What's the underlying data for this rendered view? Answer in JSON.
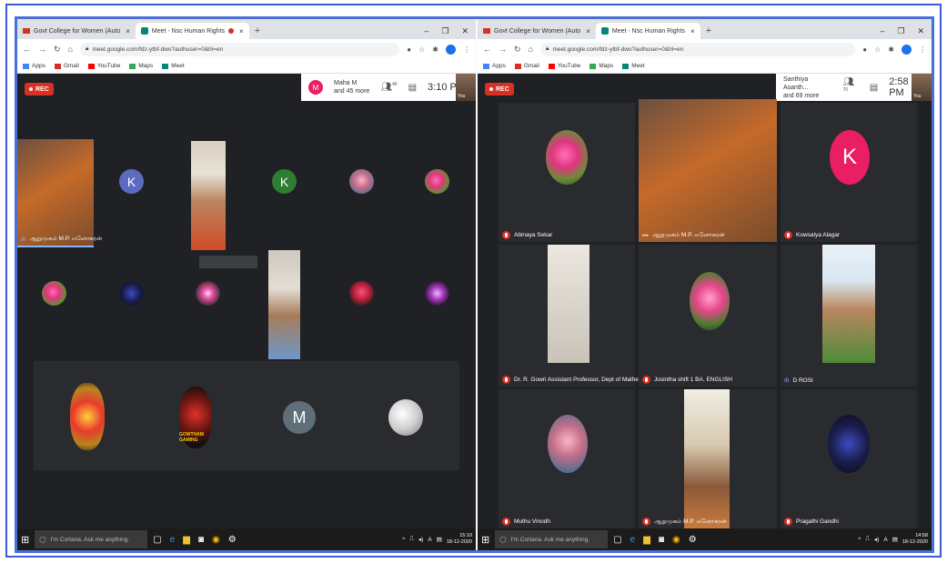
{
  "left": {
    "tabs": [
      {
        "label": "Govt College for Women (Auto"
      },
      {
        "label": "Meet - Nsc Human Rights"
      }
    ],
    "url": "meet.google.com/fdz-ytbf-dwo?authuser=0&hl=en",
    "bookmarks": [
      "Apps",
      "Gmail",
      "YouTube",
      "Maps",
      "Meet"
    ],
    "rec_label": "REC",
    "presenter_initial": "M",
    "presenter_line1": "Maha M",
    "presenter_line2": "and 45 more",
    "participant_count": "46",
    "time": "3:10 PM",
    "self_label": "You",
    "grid": {
      "speaker_name": "ஆறுமுகம் M.P. மனோகரன்",
      "banner_text": "",
      "avatar_k1": "K",
      "avatar_k2": "K",
      "avatar_m": "M",
      "gaming_text": "GOWTHAM GAMING"
    },
    "taskbar": {
      "search_placeholder": "I'm Cortana. Ask me anything.",
      "clock_time": "15:10",
      "clock_date": "18-12-2020"
    }
  },
  "right": {
    "tabs": [
      {
        "label": "Govt College for Women (Auto"
      },
      {
        "label": "Meet - Nsc Human Rights"
      }
    ],
    "url": "meet.google.com/fdz-ytbf-dwo?authuser=0&hl=en",
    "bookmarks": [
      "Apps",
      "Gmail",
      "YouTube",
      "Maps",
      "Meet"
    ],
    "rec_label": "REC",
    "presenter_line1": "Santhiya Asanth...",
    "presenter_line2": "and 69 more",
    "participant_count": "70",
    "time": "2:58 PM",
    "self_label": "You",
    "grid": {
      "names": [
        "Abinaya Sekar",
        "ஆறுமுகம் M.P. மனோகரன்",
        "Kowsalya Alagar",
        "Dr. R. Gowri Assistant Professor, Dept of Mathematics",
        "Josintha shift 1 BA. ENGLISH",
        "D ROSI",
        "Muthu Vinodh",
        "ஆறுமுகம் M.P. மனோகரன்",
        "Pragathi Gandhi"
      ],
      "avatar_k": "K"
    },
    "taskbar": {
      "search_placeholder": "I'm Cortana. Ask me anything.",
      "clock_time": "14:58",
      "clock_date": "18-12-2020"
    }
  },
  "colors": {
    "frame_border": "#4a6fd8",
    "meet_bg": "#202124",
    "rec_red": "#d93025",
    "avatar_k_blue": "#5c6bc0",
    "avatar_k_green": "#2e7d32",
    "avatar_m_gray": "#5f6f7a",
    "avatar_k_pink": "#e91e63"
  }
}
